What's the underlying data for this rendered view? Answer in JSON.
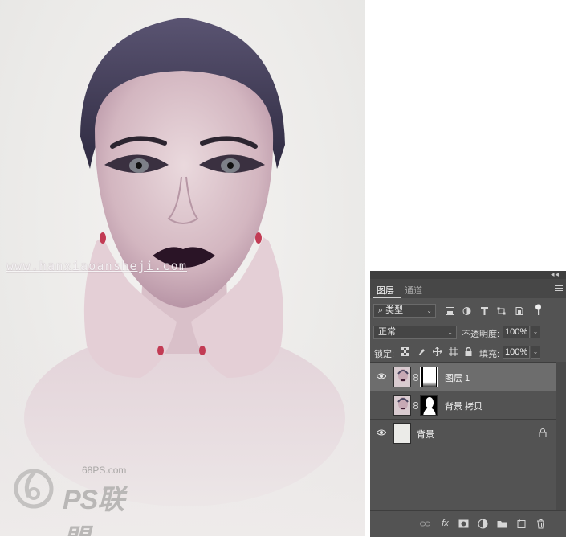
{
  "photo": {
    "watermark": "www.hanxiaoansheji.com",
    "logo_site": "68PS.com",
    "logo_name": "PS联盟"
  },
  "panel": {
    "collapse_glyph": "◂◂",
    "tabs": [
      {
        "label": "图层",
        "active": true
      },
      {
        "label": "通道",
        "active": false
      }
    ],
    "filter": {
      "kind": "类型",
      "icons": [
        "image-filter-icon",
        "adjustment-filter-icon",
        "type-filter-icon",
        "shape-filter-icon",
        "smart-object-filter-icon",
        "filter-toggle-icon"
      ]
    },
    "blend_mode": "正常",
    "opacity_label": "不透明度:",
    "opacity_value": "100%",
    "lock_label": "锁定:",
    "fill_label": "填充:",
    "fill_value": "100%",
    "layers": [
      {
        "name": "图层 1",
        "visible": true,
        "selected": true,
        "has_mask": true
      },
      {
        "name": "背景 拷贝",
        "visible": false,
        "selected": false,
        "has_mask": true
      },
      {
        "name": "背景",
        "visible": true,
        "selected": false,
        "locked": true
      }
    ],
    "bottom_icons": [
      "link-icon",
      "fx-icon",
      "mask-icon",
      "adjustment-icon",
      "group-icon",
      "new-layer-icon",
      "trash-icon"
    ],
    "fx_label": "fx"
  },
  "colors": {
    "panel_bg": "#535353",
    "selected_row": "#6d6d6d",
    "tab_bar": "#474747"
  }
}
